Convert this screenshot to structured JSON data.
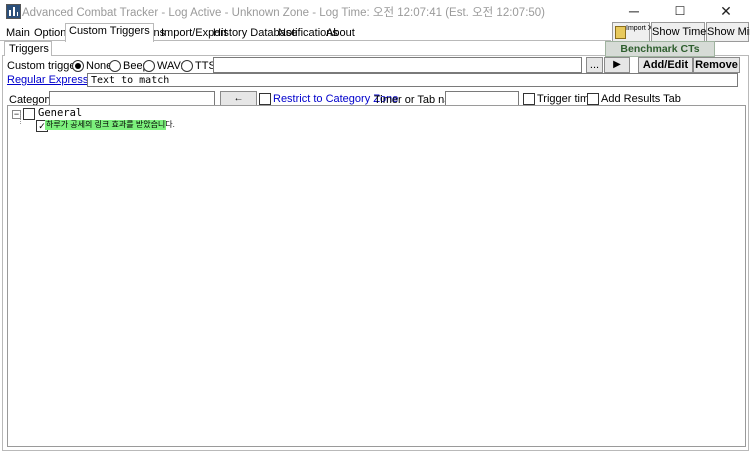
{
  "window": {
    "title": "Advanced Combat Tracker - Log Active - Unknown Zone - Log Time: 오전 12:07:41 (Est. 오전 12:07:50)",
    "controls": {
      "minimize": "─",
      "maximize": "☐",
      "close": "✕"
    }
  },
  "tabs": [
    {
      "label": "Main"
    },
    {
      "label": "Options"
    },
    {
      "label": "Custom Triggers",
      "active": true
    },
    {
      "label": "Plugins"
    },
    {
      "label": "Import/Export"
    },
    {
      "label": "History Database"
    },
    {
      "label": "Notifications"
    },
    {
      "label": "About"
    }
  ],
  "toolbar": {
    "import_xml": "Import XML",
    "show_timers": "Show Timers",
    "show_mini": "Show Mini",
    "benchmark": "Benchmark CTs"
  },
  "triggers_tab": "Triggers",
  "custom_trigger": {
    "label": "Custom trigger:",
    "options": [
      "None",
      "Beep",
      "WAV:",
      "TTS:"
    ],
    "selected": "None",
    "browse": "...",
    "play": "▶",
    "add_edit": "Add/Edit",
    "remove": "Remove"
  },
  "regex": {
    "label": "Regular Expression:",
    "value": "Text to match"
  },
  "category_row": {
    "category_label": "Category",
    "category_value": "",
    "zone_button": "← Zone",
    "restrict_label": "Restrict to Category Zone",
    "timer_label": "Timer or Tab name",
    "timer_value": "",
    "trigger_timer": "Trigger timer",
    "add_results_tab": "Add Results Tab"
  },
  "tree": {
    "expander": "−",
    "category": "General",
    "item": "하루가 공세의 링크 효과를 받았습니다."
  },
  "colors": {
    "highlight": "#7cf07c",
    "link": "#0000cc",
    "benchmark_text": "#2e5e2e"
  }
}
